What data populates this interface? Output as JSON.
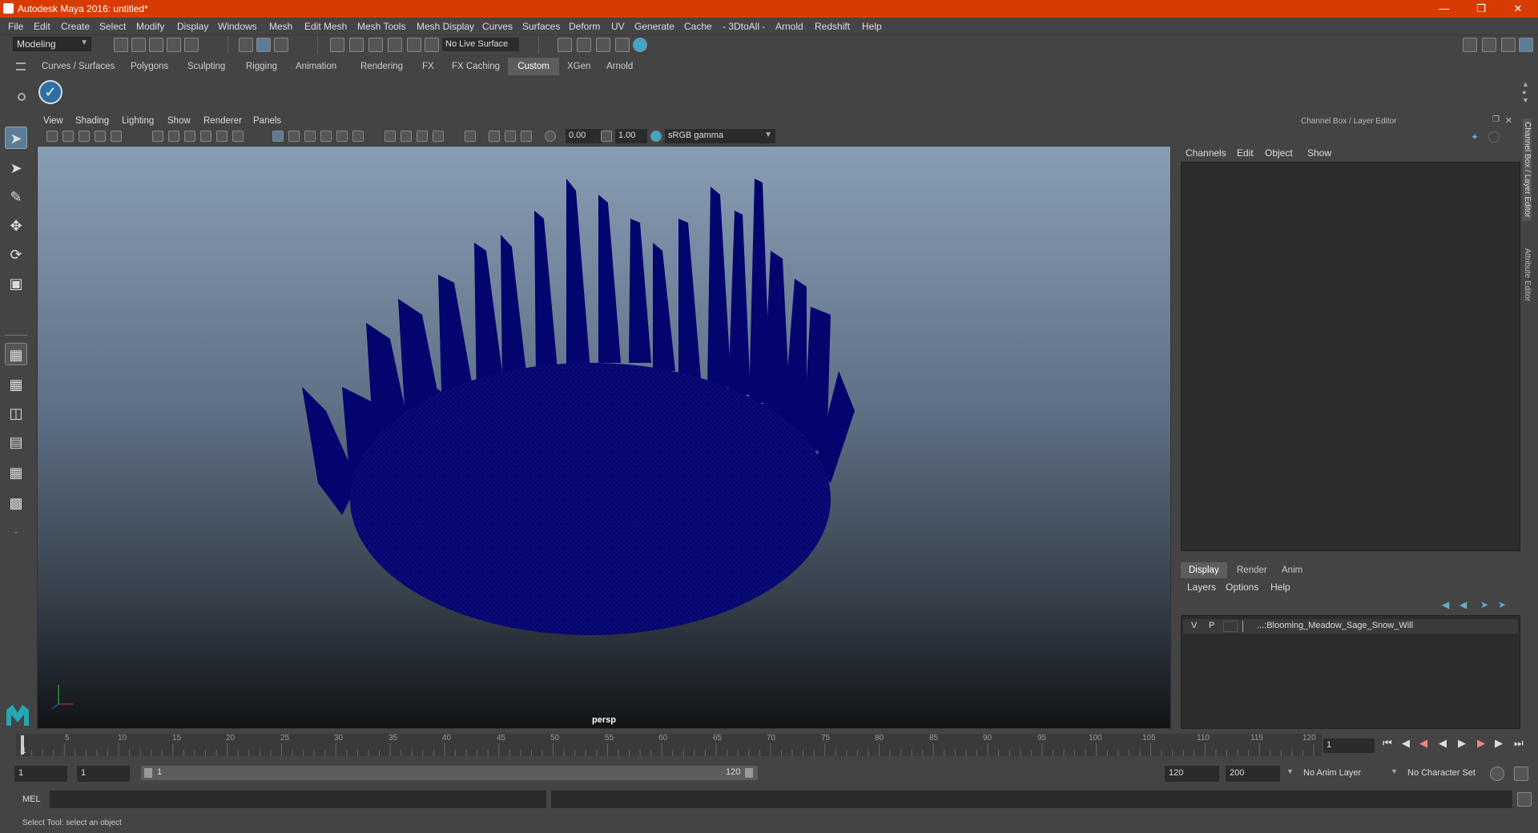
{
  "window": {
    "title": "Autodesk Maya 2016: untitled*"
  },
  "menubar": [
    "File",
    "Edit",
    "Create",
    "Select",
    "Modify",
    "Display",
    "Windows",
    "Mesh",
    "Edit Mesh",
    "Mesh Tools",
    "Mesh Display",
    "Curves",
    "Surfaces",
    "Deform",
    "UV",
    "Generate",
    "Cache",
    "- 3DtoAll -",
    "Arnold",
    "Redshift",
    "Help"
  ],
  "statusline": {
    "mode": "Modeling",
    "live_surface": "No Live Surface"
  },
  "shelf_tabs": [
    "Curves / Surfaces",
    "Polygons",
    "Sculpting",
    "Rigging",
    "Animation",
    "Rendering",
    "FX",
    "FX Caching",
    "Custom",
    "XGen",
    "Arnold"
  ],
  "shelf_active": "Custom",
  "viewport": {
    "menu": [
      "View",
      "Shading",
      "Lighting",
      "Show",
      "Renderer",
      "Panels"
    ],
    "exposure": "0.00",
    "gamma": "1.00",
    "colorspace": "sRGB gamma",
    "camera": "persp"
  },
  "channel_box": {
    "title": "Channel Box / Layer Editor",
    "menu": [
      "Channels",
      "Edit",
      "Object",
      "Show"
    ]
  },
  "layer_editor": {
    "tabs": [
      "Display",
      "Render",
      "Anim"
    ],
    "active_tab": "Display",
    "menu": [
      "Layers",
      "Options",
      "Help"
    ],
    "layer": {
      "v": "V",
      "p": "P",
      "name": "...:Blooming_Meadow_Sage_Snow_Will"
    }
  },
  "side_tabs": [
    "Channel Box / Layer Editor",
    "Attribute Editor"
  ],
  "timeline": {
    "ticks": [
      "1",
      "5",
      "10",
      "15",
      "20",
      "25",
      "30",
      "35",
      "40",
      "45",
      "50",
      "55",
      "60",
      "65",
      "70",
      "75",
      "80",
      "85",
      "90",
      "95",
      "100",
      "105",
      "110",
      "115",
      "120"
    ],
    "current_frame": "1"
  },
  "range": {
    "start": "1",
    "playback_start": "1",
    "slider_start": "1",
    "slider_end": "120",
    "playback_end": "120",
    "end": "200",
    "anim_layer": "No Anim Layer",
    "char_set": "No Character Set"
  },
  "command": {
    "label": "MEL"
  },
  "help_line": "Select Tool: select an object"
}
